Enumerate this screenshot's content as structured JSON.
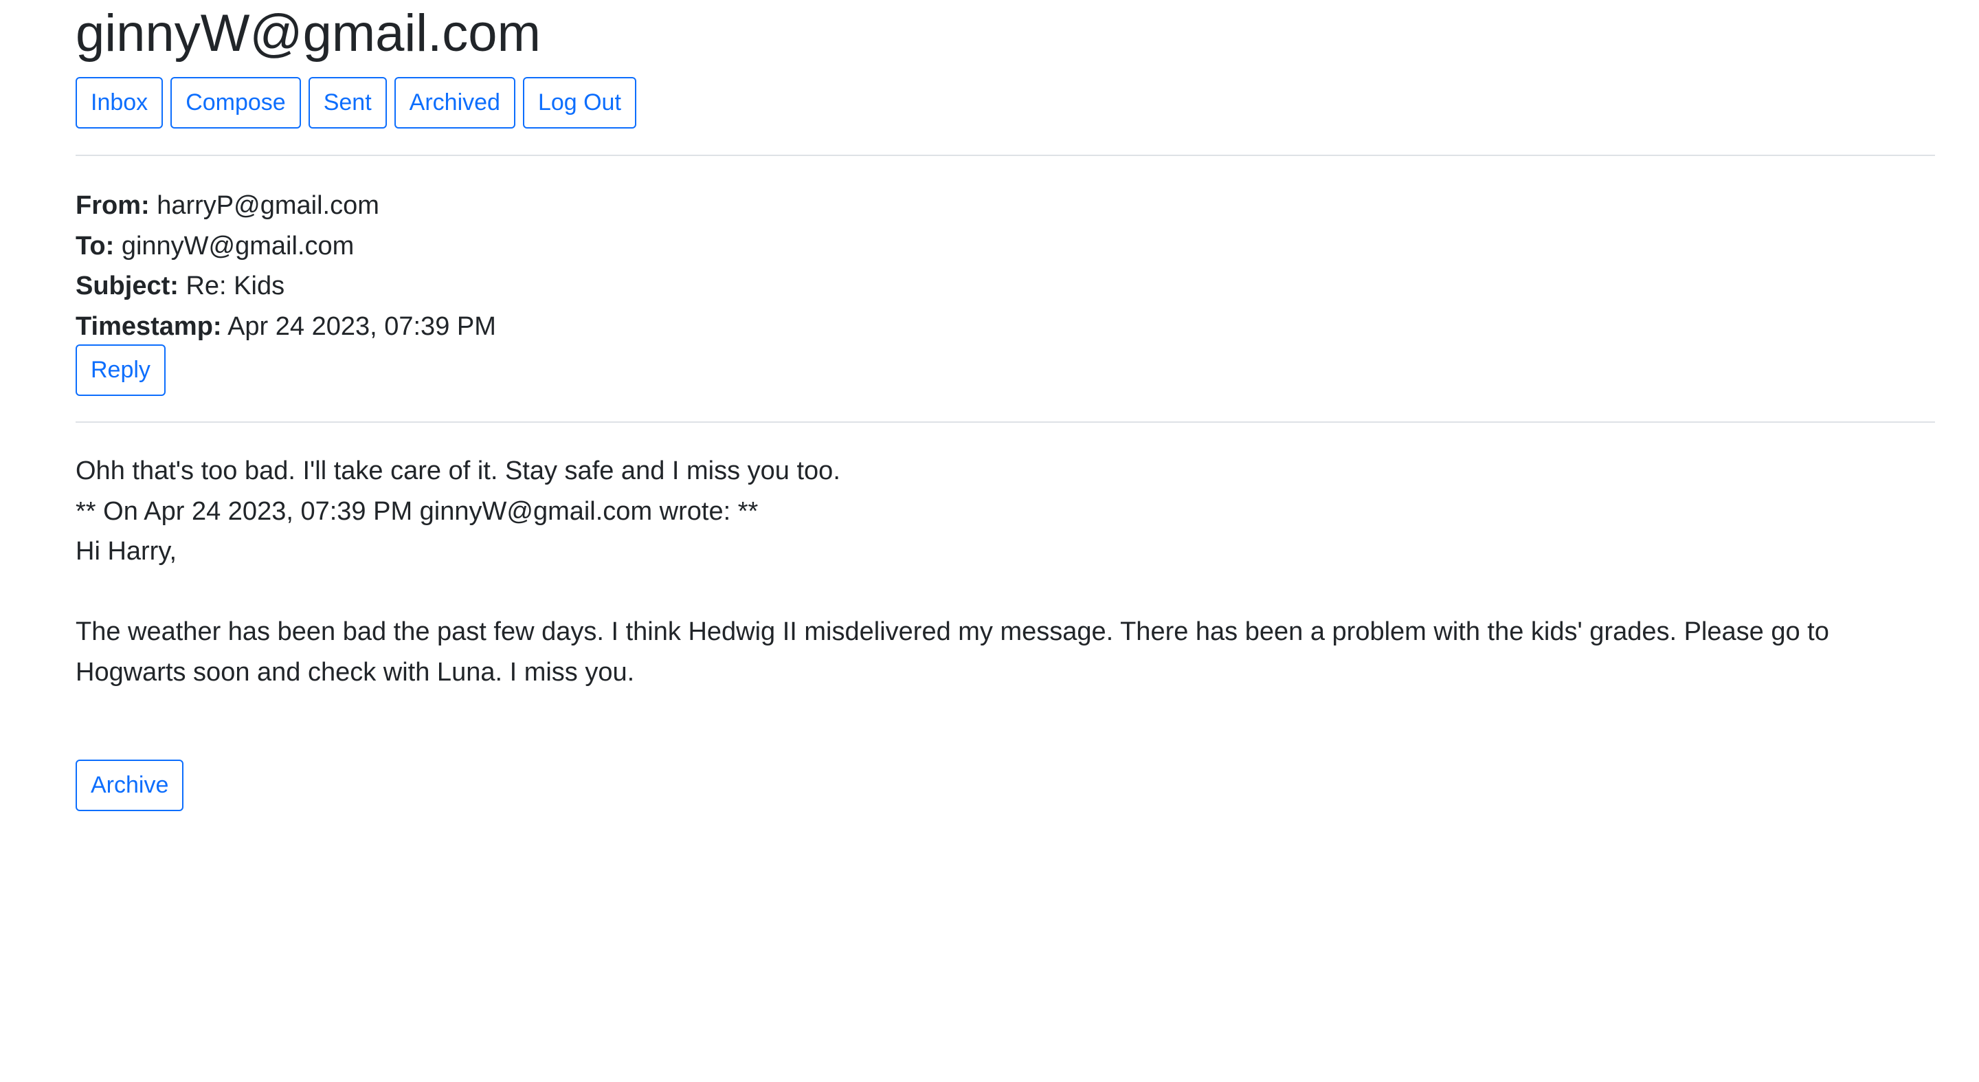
{
  "header": {
    "account": "ginnyW@gmail.com"
  },
  "nav": {
    "inbox": "Inbox",
    "compose": "Compose",
    "sent": "Sent",
    "archived": "Archived",
    "logout": "Log Out"
  },
  "email": {
    "from_label": "From:",
    "from": "harryP@gmail.com",
    "to_label": "To:",
    "to": "ginnyW@gmail.com",
    "subject_label": "Subject:",
    "subject": "Re: Kids",
    "timestamp_label": "Timestamp:",
    "timestamp": "Apr 24 2023, 07:39 PM",
    "reply_label": "Reply",
    "body": {
      "line1": "Ohh that's too bad. I'll take care of it. Stay safe and I miss you too.",
      "line2": "** On Apr 24 2023, 07:39 PM ginnyW@gmail.com wrote: **",
      "line3": "Hi Harry,",
      "line4": "",
      "line5": "The weather has been bad the past few days. I think Hedwig II misdelivered my message. There has been a problem with the kids' grades. Please go to Hogwarts soon and check with Luna. I miss you."
    },
    "archive_label": "Archive"
  }
}
